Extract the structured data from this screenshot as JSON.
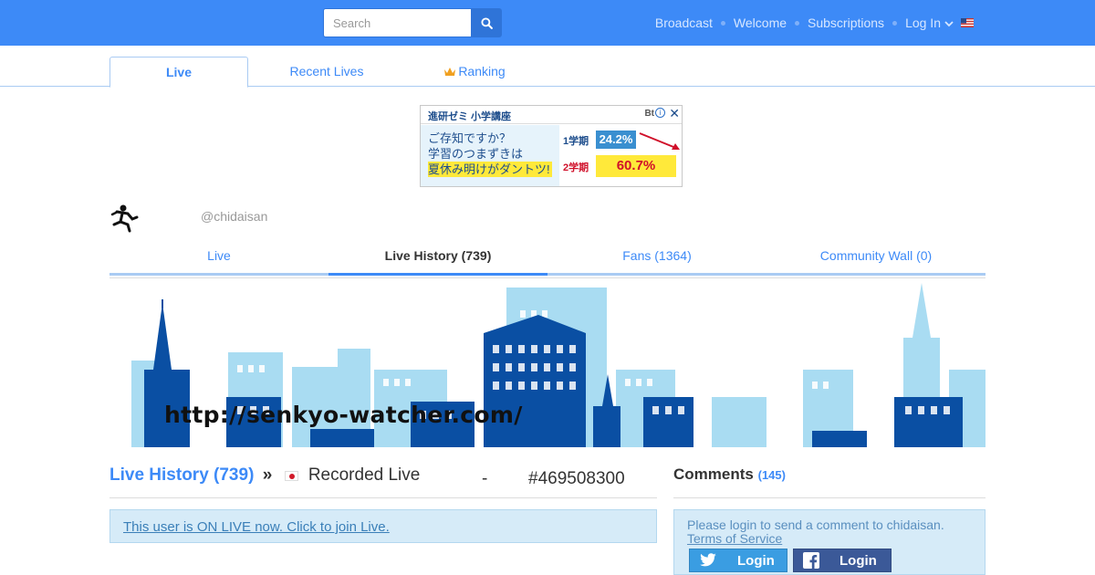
{
  "topbar": {
    "search_placeholder": "Search",
    "nav": [
      "Broadcast",
      "Welcome",
      "Subscriptions",
      "Log In"
    ],
    "accent": "#3d8af7"
  },
  "main_tabs": [
    "Live",
    "Recent Lives",
    "Ranking"
  ],
  "ad": {
    "brand": "進研ゼミ 小学講座",
    "line1": "ご存知ですか？",
    "line2": "学習のつまずきは",
    "line3": "夏休み明けがダントツ!",
    "term1": "1学期",
    "term1_value": "24.2%",
    "term2": "2学期",
    "term2_value": "60.7%",
    "ad_badge": "Bt"
  },
  "profile": {
    "handle": "@chidaisan",
    "tabs": [
      "Live",
      "Live History (739)",
      "Fans (1364)",
      "Community Wall (0)"
    ]
  },
  "banner": {
    "url_text": "http://senkyo-watcher.com/"
  },
  "history": {
    "link": "Live History (739)",
    "sep": "»",
    "title": "Recorded Live",
    "dash": "-",
    "id": "#469508300",
    "onlive_notice": "This user is ON LIVE now. Click to join Live."
  },
  "comments": {
    "heading": "Comments",
    "count": "145",
    "login_prompt": "Please login to send a comment to chidaisan.",
    "tos": "Terms of Service",
    "twitter_login": "Login",
    "facebook_login": "Login"
  }
}
